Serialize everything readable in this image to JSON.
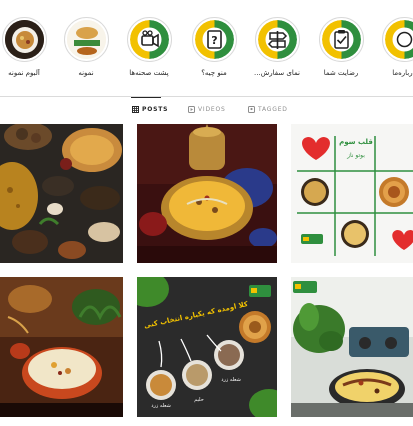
{
  "highlights": [
    {
      "label": "آلبوم نمونه",
      "icon": "food-photo-icon"
    },
    {
      "label": "نمونه",
      "icon": "food-photo-icon"
    },
    {
      "label": "پشت صحنه‌ها",
      "icon": "camera-icon"
    },
    {
      "label": "منو چیه؟",
      "icon": "question-icon"
    },
    {
      "label": "...نمای سفارش",
      "icon": "signpost-icon"
    },
    {
      "label": "رضایت شما",
      "icon": "clipboard-check-icon"
    },
    {
      "label": "درباره‌ما",
      "icon": "info-icon"
    }
  ],
  "tabs": {
    "posts": "POSTS",
    "videos": "VIDEOS",
    "tagged": "TAGGED"
  },
  "posts": {
    "post3_title": "قلب سوم",
    "post3_subtitle": "بوتو ناز",
    "post5_title": "کلا اومده که یکباره انتخاب کنی",
    "post5_labels": [
      "شعله زرد",
      "حلیم",
      "شعله زرد"
    ]
  },
  "colors": {
    "brand_green": "#2f8f3e",
    "brand_yellow": "#f2c100",
    "text": "#262626",
    "muted": "#8e8e8e"
  }
}
